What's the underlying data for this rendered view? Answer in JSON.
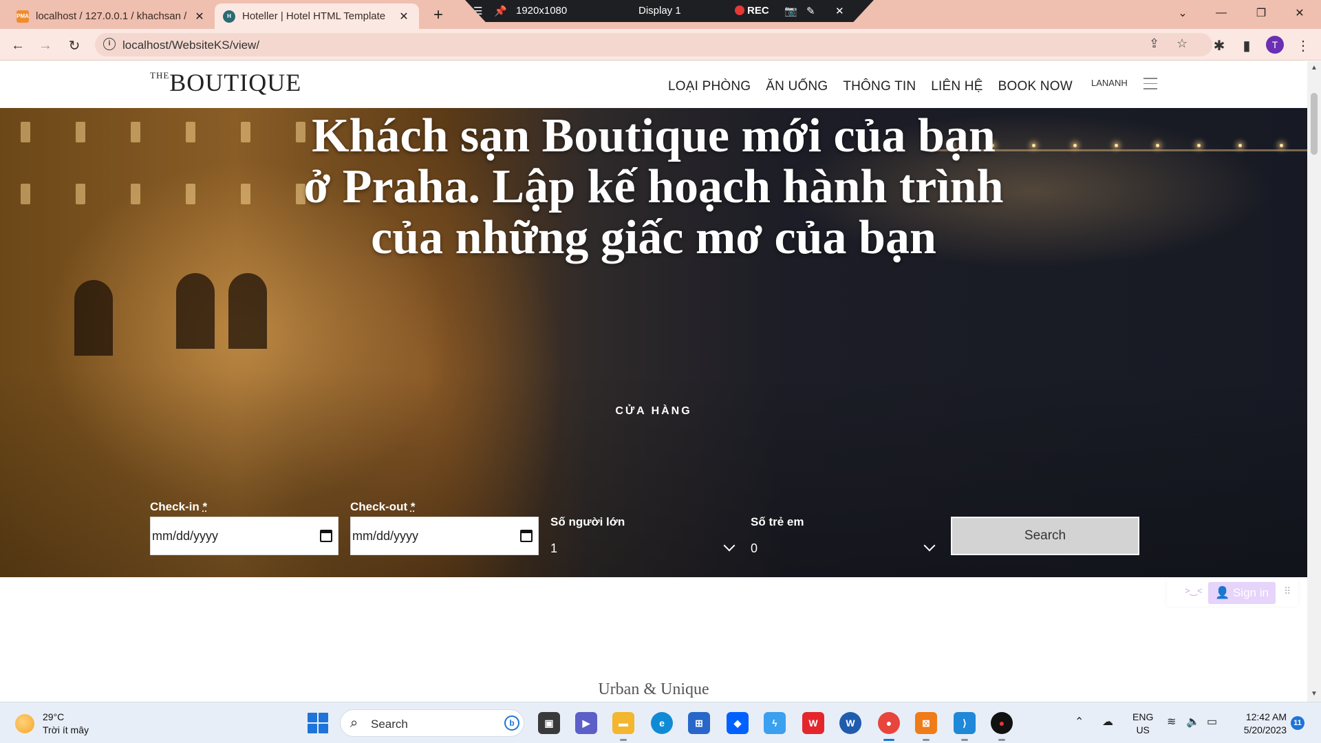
{
  "browser": {
    "tabs": [
      {
        "title": "localhost / 127.0.0.1 / khachsan /",
        "favicon": "phpmyadmin-icon",
        "active": false
      },
      {
        "title": "Hoteller | Hotel HTML Template",
        "favicon": "site-icon",
        "active": true
      }
    ],
    "new_tab_symbol": "+",
    "url": "localhost/WebsiteKS/view/",
    "profile_initial": "T"
  },
  "recorder": {
    "resolution": "1920x1080",
    "display": "Display 1",
    "rec_label": "REC"
  },
  "site": {
    "logo": {
      "prefix": "THE",
      "name": "BOUTIQUE"
    },
    "nav": [
      "LOẠI PHÒNG",
      "ĂN UỐNG",
      "THÔNG TIN",
      "LIÊN HỆ",
      "BOOK NOW"
    ],
    "user": "LANANH"
  },
  "hero": {
    "title": "Khách sạn Boutique mới của bạn ở Praha. Lập kế hoạch hành trình của những giấc mơ của bạn",
    "cta": "CỬA HÀNG"
  },
  "booking": {
    "checkin": {
      "label": "Check-in",
      "required": "*",
      "placeholder": "mm/dd/yyyy"
    },
    "checkout": {
      "label": "Check-out",
      "required": "*",
      "placeholder": "mm/dd/yyyy"
    },
    "adults": {
      "label": "Số người lớn",
      "value": "1"
    },
    "children": {
      "label": "Số trẻ em",
      "value": "0"
    },
    "search_label": "Search"
  },
  "widget": {
    "signin_label": "Sign in"
  },
  "tagline": "Urban & Unique",
  "taskbar": {
    "weather": {
      "temp": "29°C",
      "desc": "Trời ít mây"
    },
    "search_label": "Search",
    "lang": {
      "line1": "ENG",
      "line2": "US"
    },
    "time": "12:42 AM",
    "date": "5/20/2023",
    "notifications": "11"
  }
}
